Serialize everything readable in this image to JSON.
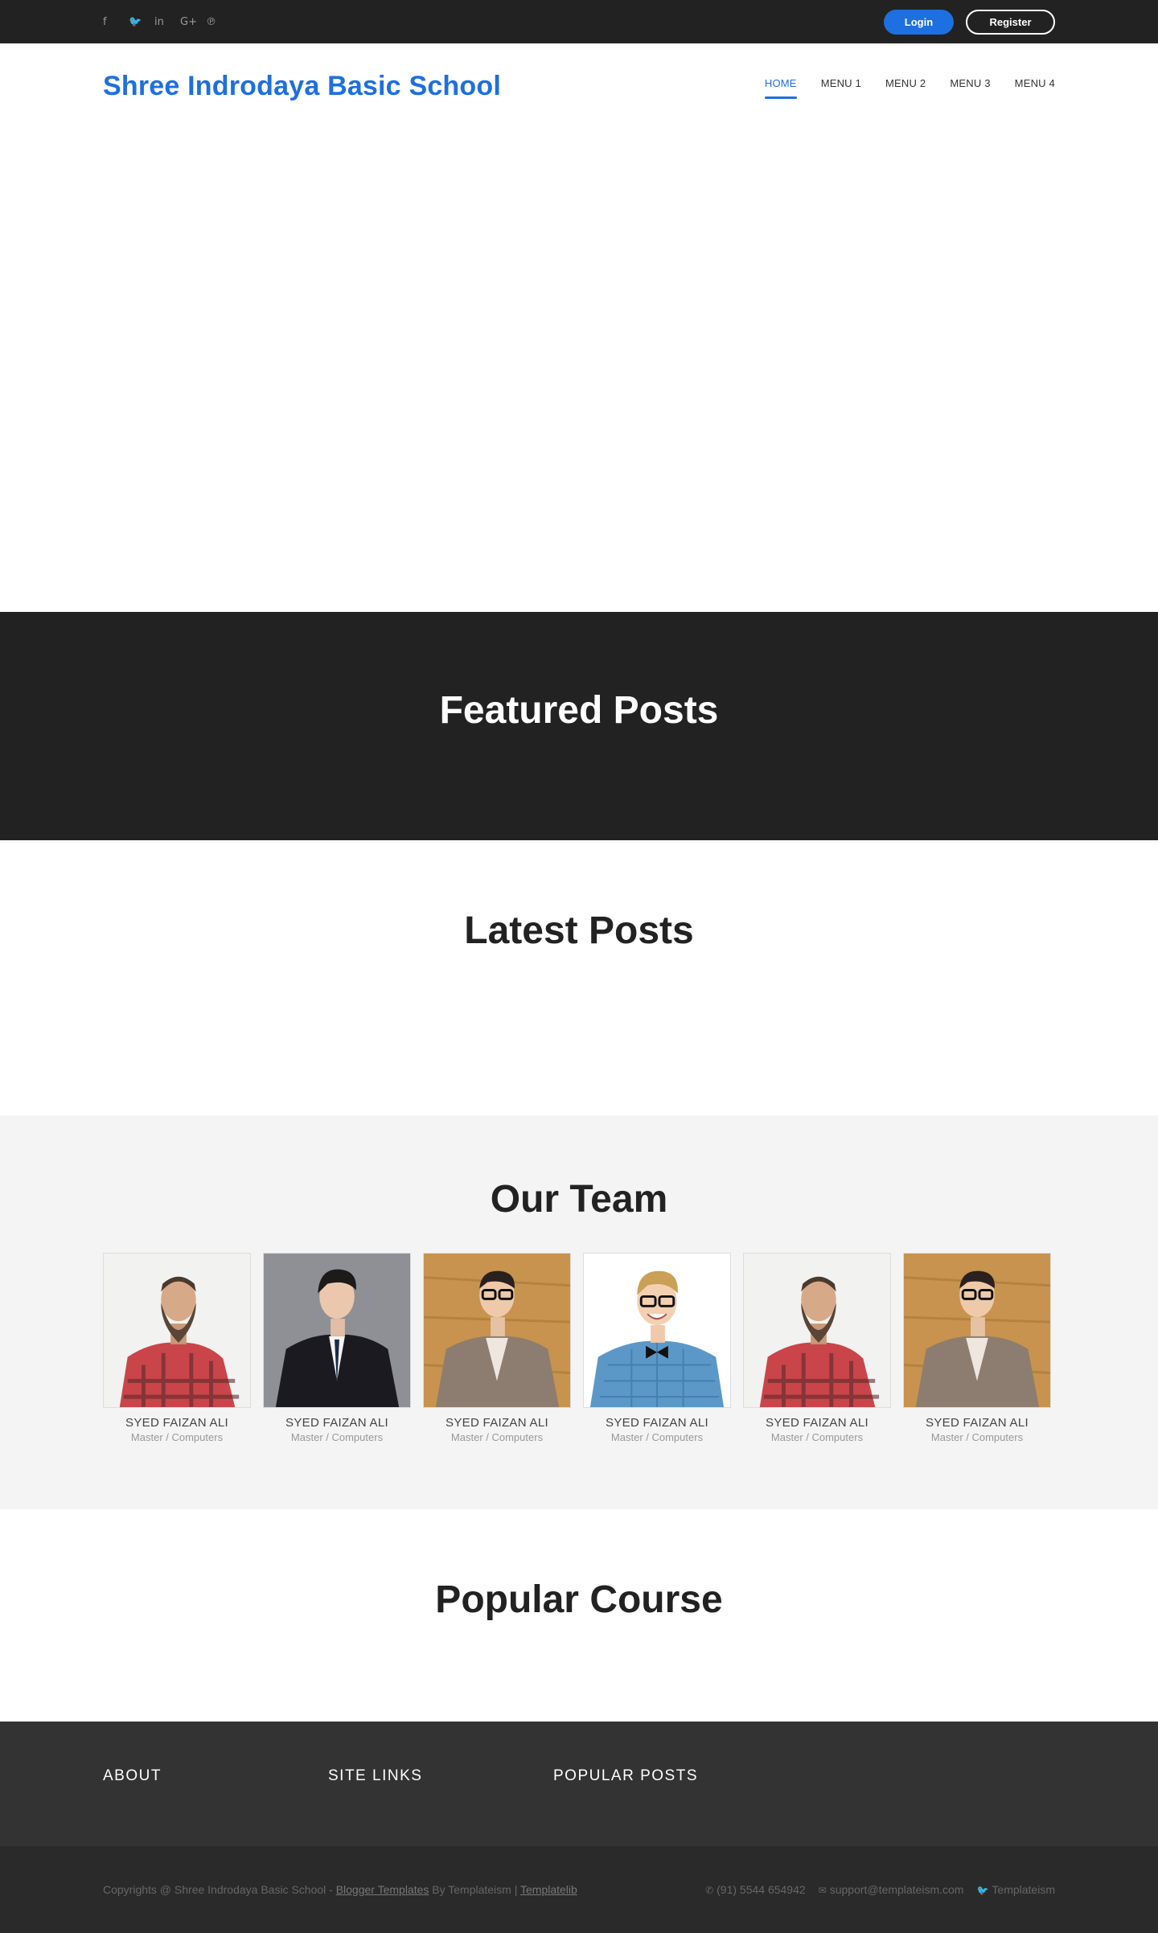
{
  "topbar": {
    "social": [
      {
        "name": "facebook-icon",
        "glyph": "f"
      },
      {
        "name": "twitter-icon",
        "glyph": "🐦"
      },
      {
        "name": "linkedin-icon",
        "glyph": "in"
      },
      {
        "name": "google-plus-icon",
        "glyph": "G+"
      },
      {
        "name": "pinterest-icon",
        "glyph": "℗"
      }
    ],
    "login_label": "Login",
    "register_label": "Register"
  },
  "header": {
    "site_title": "Shree Indrodaya Basic School",
    "menu": [
      "HOME",
      "MENU 1",
      "MENU 2",
      "MENU 3",
      "MENU 4"
    ],
    "active_index": 0
  },
  "sections": {
    "featured_title": "Featured Posts",
    "latest_title": "Latest Posts",
    "team_title": "Our Team",
    "popular_title": "Popular Course"
  },
  "team": [
    {
      "name": "SYED FAIZAN ALI",
      "role": "Master / Computers",
      "photo": "bearded-man-plaid"
    },
    {
      "name": "SYED FAIZAN ALI",
      "role": "Master / Computers",
      "photo": "man-black-suit"
    },
    {
      "name": "SYED FAIZAN ALI",
      "role": "Master / Computers",
      "photo": "man-glasses-cardigan"
    },
    {
      "name": "SYED FAIZAN ALI",
      "role": "Master / Computers",
      "photo": "smiling-man-bowtie"
    },
    {
      "name": "SYED FAIZAN ALI",
      "role": "Master / Computers",
      "photo": "bearded-man-plaid"
    },
    {
      "name": "SYED FAIZAN ALI",
      "role": "Master / Computers",
      "photo": "man-glasses-cardigan"
    }
  ],
  "footer": {
    "about": "ABOUT",
    "site_links": "SITE LINKS",
    "popular_posts": "POPULAR POSTS"
  },
  "bottom": {
    "copyright_prefix": "Copyrights @ Shree Indrodaya Basic School - ",
    "blogger_link": "Blogger Templates",
    "by_text": " By Templateism | ",
    "templatelib_link": "Templatelib",
    "phone": "(91) 5544 654942",
    "email": "support@templateism.com",
    "twitter": "Templateism"
  },
  "colors": {
    "accent": "#1e6fe0",
    "dark": "#222222",
    "footer": "#333333",
    "team_bg": "#f4f4f4"
  }
}
